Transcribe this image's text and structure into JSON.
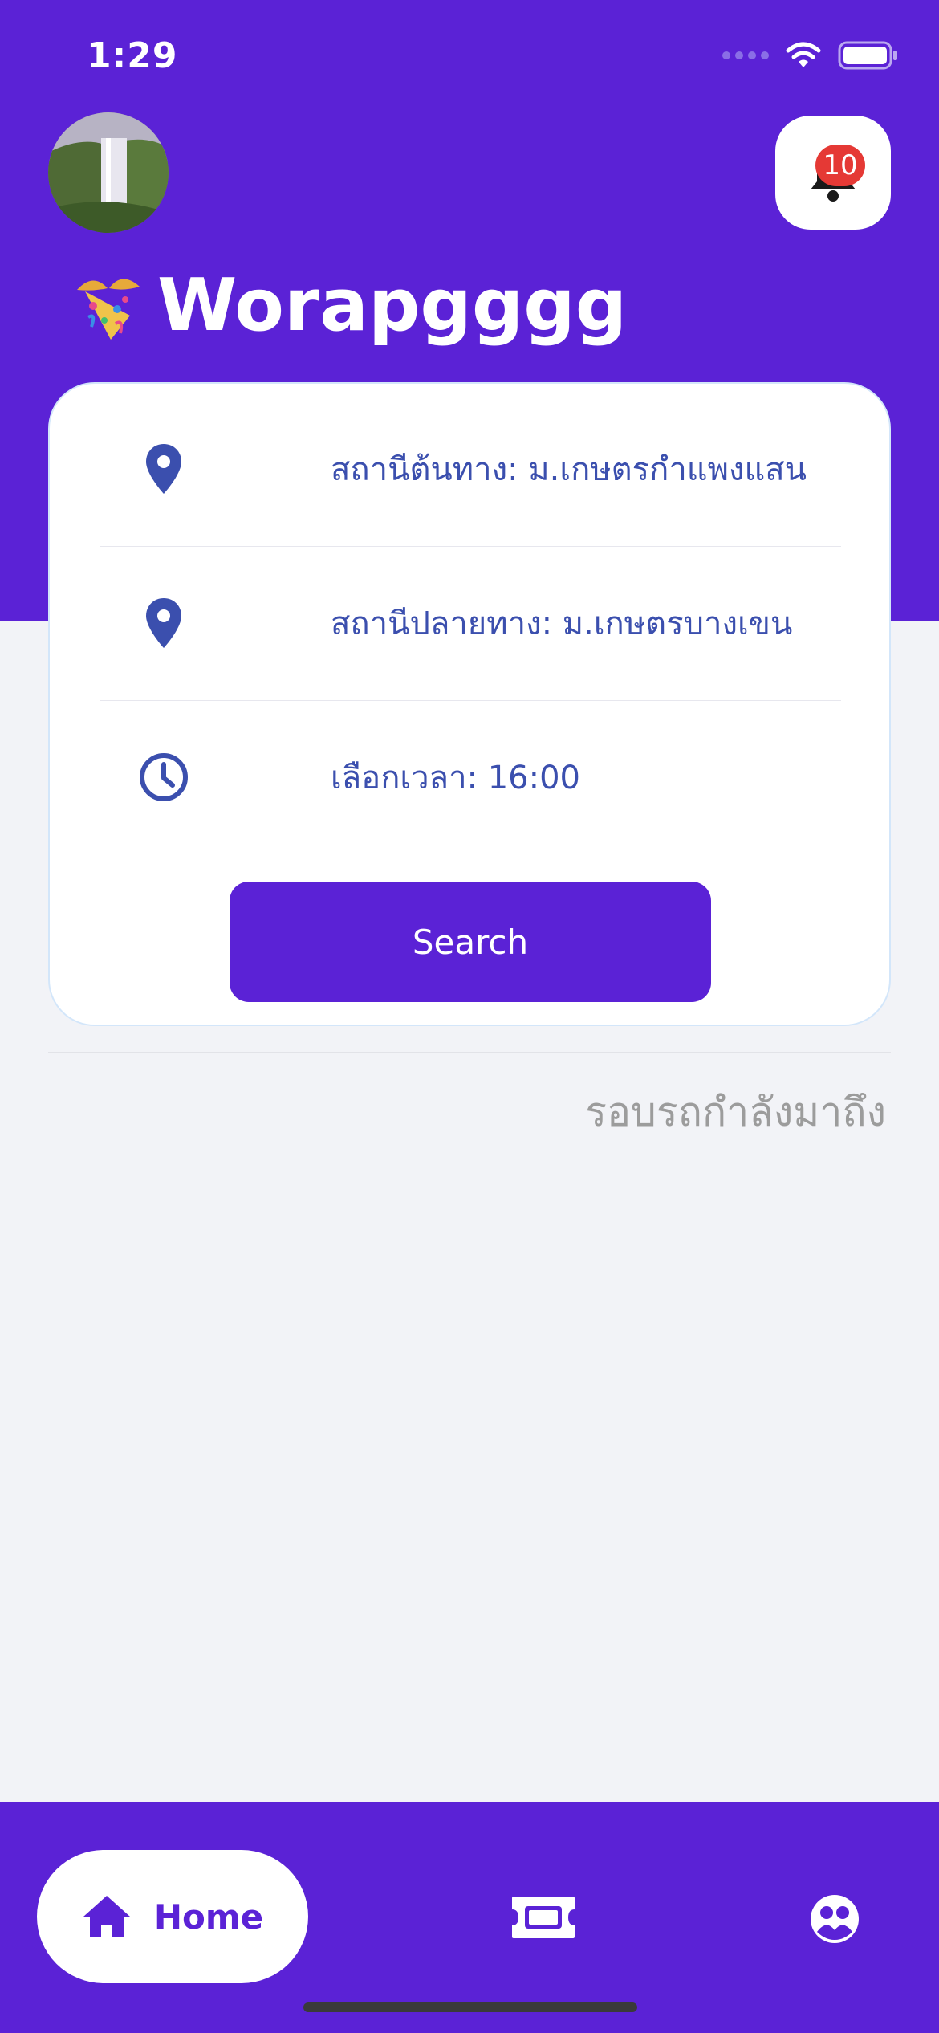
{
  "status_bar": {
    "time": "1:29"
  },
  "header": {
    "greeting_name": "Worapgggg",
    "notification_count": "10"
  },
  "search_card": {
    "origin_label": "สถานีต้นทาง: ม.เกษตรกำแพงแสน",
    "destination_label": "สถานีปลายทาง: ม.เกษตรบางเขน",
    "time_label": "เลือกเวลา: 16:00",
    "search_button": "Search"
  },
  "upcoming": {
    "title": "รอบรถกำลังมาถึง"
  },
  "bottom_nav": {
    "home_label": "Home"
  },
  "colors": {
    "primary": "#5b22d6",
    "icon_blue": "#3b4fae",
    "badge_red": "#e53935",
    "background": "#f2f3f7"
  }
}
